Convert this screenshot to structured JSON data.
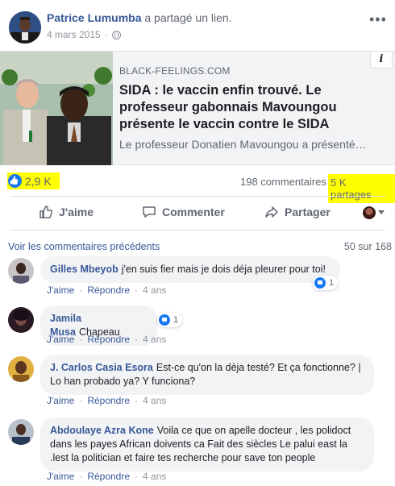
{
  "header": {
    "author_name": "Patrice Lumumba",
    "action_text": "a partagé un lien.",
    "date": "4 mars 2015"
  },
  "link_card": {
    "domain": "BLACK-FEELINGS.COM",
    "title": "SIDA : le vaccin enfin trouvé. Le professeur gabonnais Mavoungou présente le vaccin contre le SIDA",
    "description": "Le professeur Donatien Mavoungou a présenté…"
  },
  "stats": {
    "likes": "2,9 K",
    "comments": "198 commentaires",
    "shares": "5 K partages"
  },
  "actions": {
    "like": "J'aime",
    "comment": "Commenter",
    "share": "Partager"
  },
  "comments_section": {
    "view_previous": "Voir les commentaires précédents",
    "count": "50 sur 168",
    "items": [
      {
        "author": "Gilles Mbeyob",
        "text": "j'en suis fier mais je dois déja pleurer pour toi!",
        "reactions": "1",
        "like": "J'aime",
        "reply": "Répondre",
        "time": "4 ans"
      },
      {
        "author": "Jamila Musa",
        "text": "Chapeau",
        "reactions": "1",
        "like": "J'aime",
        "reply": "Répondre",
        "time": "4 ans"
      },
      {
        "author": "J. Carlos Casia Esora",
        "text": "Est-ce qu'on la dèja testé? Et ça fonctionne? | Lo han probado ya? Y funciona?",
        "like": "J'aime",
        "reply": "Répondre",
        "time": "4 ans"
      },
      {
        "author": "Abdoulaye Azra Kone",
        "text": "Voila ce que on apelle docteur , les polidoct dans les payes African doivents ca Fait des siècles Le palui east la .lest la politician et faire tes recherche pour save ton people",
        "like": "J'aime",
        "reply": "Répondre",
        "time": "4 ans"
      }
    ]
  },
  "colors": {
    "link_blue": "#385898",
    "highlight": "#ffff00",
    "like_blue": "#1877f2",
    "bubble_bg": "#f2f3f5"
  }
}
